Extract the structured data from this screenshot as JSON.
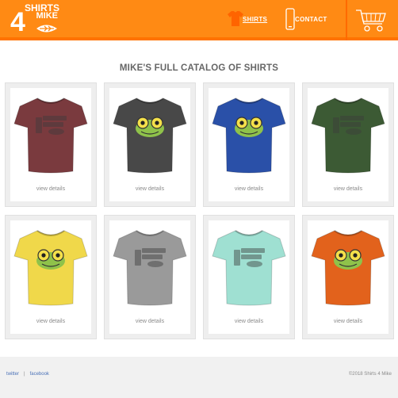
{
  "brand": {
    "logo_top": "SHIRTS",
    "logo_mid": "MIKE",
    "logo_digit": "4",
    "accent": "#ff8a14",
    "accent_dark": "#ff7300"
  },
  "nav": {
    "shirts_label": "SHIRTS",
    "contact_label": "CONTACT",
    "shirts_icon": "tshirt-icon",
    "contact_icon": "phone-icon",
    "cart_icon": "shopping-cart-icon"
  },
  "main": {
    "title": "MIKE'S FULL CATALOG OF SHIRTS",
    "products": [
      {
        "color": "#7a3a3e",
        "design": "logo",
        "link": "view details"
      },
      {
        "color": "#484848",
        "design": "frog",
        "link": "view details"
      },
      {
        "color": "#2a50a8",
        "design": "frog",
        "link": "view details"
      },
      {
        "color": "#3c5a34",
        "design": "logo",
        "link": "view details"
      },
      {
        "color": "#f0d84a",
        "design": "frog",
        "link": "view details"
      },
      {
        "color": "#9a9a9a",
        "design": "logo",
        "link": "view details"
      },
      {
        "color": "#9fe0d2",
        "design": "logo",
        "link": "view details"
      },
      {
        "color": "#e2621c",
        "design": "frog",
        "link": "view details"
      }
    ]
  },
  "footer": {
    "links": [
      "twitter",
      "facebook"
    ],
    "separator": "|",
    "copyright": "©2018 Shirts 4 Mike"
  }
}
